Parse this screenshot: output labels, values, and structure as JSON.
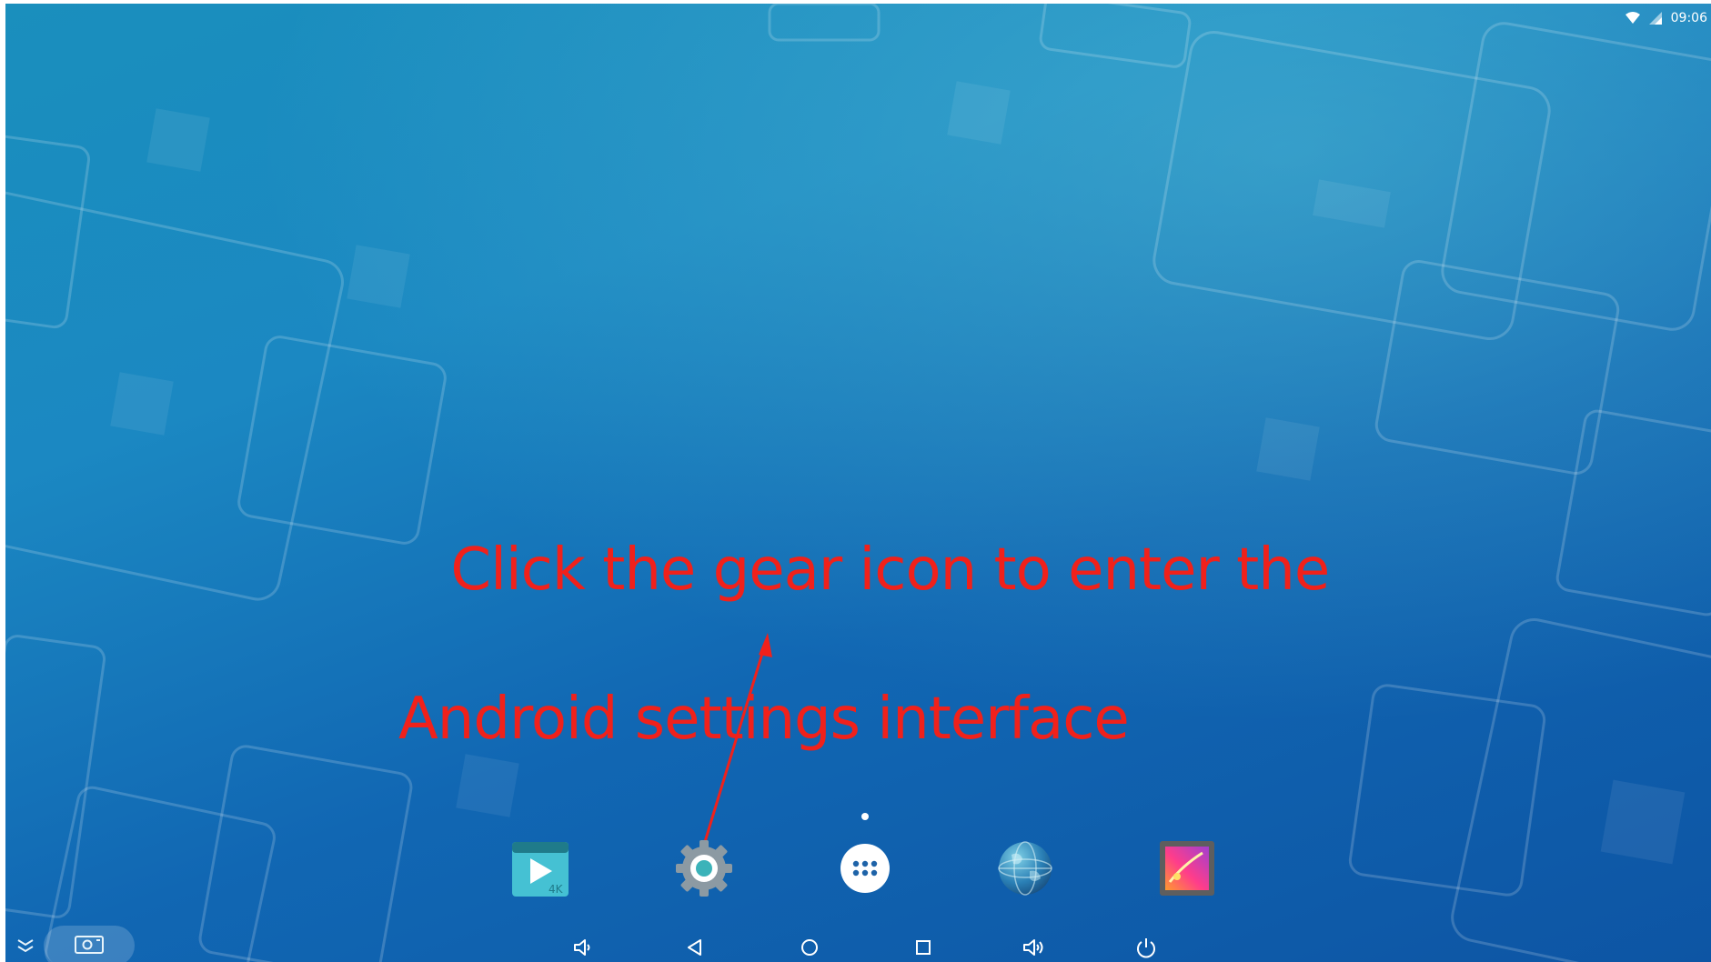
{
  "status_bar": {
    "time": "09:06",
    "wifi_icon": "wifi-icon",
    "signal_icon": "signal-icon"
  },
  "annotation": {
    "line1": "Click the gear icon to enter the",
    "line2": "Android settings interface",
    "color": "#f0211b"
  },
  "dock": {
    "apps": [
      {
        "name": "4K video player",
        "icon": "video-player-4k-icon",
        "badge": "4K"
      },
      {
        "name": "Settings",
        "icon": "gear-icon"
      },
      {
        "name": "All apps",
        "icon": "app-drawer-icon"
      },
      {
        "name": "Browser",
        "icon": "globe-icon"
      },
      {
        "name": "Gallery",
        "icon": "gallery-icon"
      }
    ]
  },
  "nav_bar": {
    "buttons": [
      "volume-down-icon",
      "back-icon",
      "home-icon",
      "recents-icon",
      "volume-up-icon",
      "power-icon"
    ],
    "left_tools": [
      "collapse-icon",
      "screenshot-icon"
    ]
  },
  "colors": {
    "wallpaper_top": "#1a8fbd",
    "wallpaper_bottom": "#0d55a4",
    "annotation_red": "#f0211b"
  }
}
